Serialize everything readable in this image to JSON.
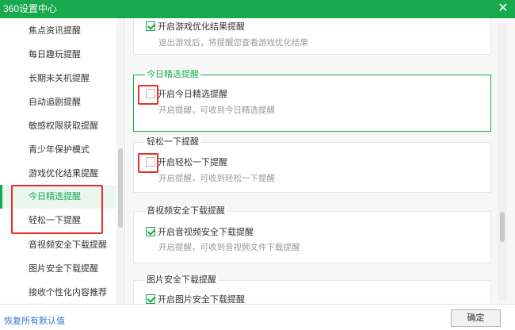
{
  "window": {
    "title": "360设置中心",
    "close_glyph": "✕"
  },
  "sidebar": {
    "items": [
      {
        "label": "焦点资讯提醒",
        "active": false
      },
      {
        "label": "每日趣玩提醒",
        "active": false
      },
      {
        "label": "长期未关机提醒",
        "active": false
      },
      {
        "label": "自动追剧提醒",
        "active": false
      },
      {
        "label": "敏感权限获取提醒",
        "active": false
      },
      {
        "label": "青少年保护模式",
        "active": false
      },
      {
        "label": "游戏优化结果提醒",
        "active": false
      },
      {
        "label": "今日精选提醒",
        "active": true
      },
      {
        "label": "轻松一下提醒",
        "active": false
      },
      {
        "label": "音视频安全下载提醒",
        "active": false
      },
      {
        "label": "图片安全下载提醒",
        "active": false
      },
      {
        "label": "接收个性化内容推荐",
        "active": false
      }
    ]
  },
  "sections": [
    {
      "title": "",
      "option": {
        "label": "开启游戏优化结果提醒",
        "checked": true
      },
      "description": "退出游戏后，将提醒您查看游戏优化结果"
    },
    {
      "title": "今日精选提醒",
      "option": {
        "label": "开启今日精选提醒",
        "checked": false
      },
      "description": "开启提醒，可收到今日精选提醒"
    },
    {
      "title": "轻松一下提醒",
      "option": {
        "label": "开启轻松一下提醒",
        "checked": false
      },
      "description": "开启提醒，可收到轻松一下提醒"
    },
    {
      "title": "音视频安全下载提醒",
      "option": {
        "label": "开启音视频安全下载提醒",
        "checked": true
      },
      "description": "开启提醒，可收到音视频文件下载提醒"
    },
    {
      "title": "图片安全下载提醒",
      "option": {
        "label": "开启图片安全下载提醒",
        "checked": true
      },
      "description": ""
    }
  ],
  "footer": {
    "restore_label": "恢复所有默认值",
    "ok_label": "确定"
  },
  "colors": {
    "accent": "#18a84e",
    "annotation": "#e8302e",
    "link": "#2b7bd2"
  }
}
